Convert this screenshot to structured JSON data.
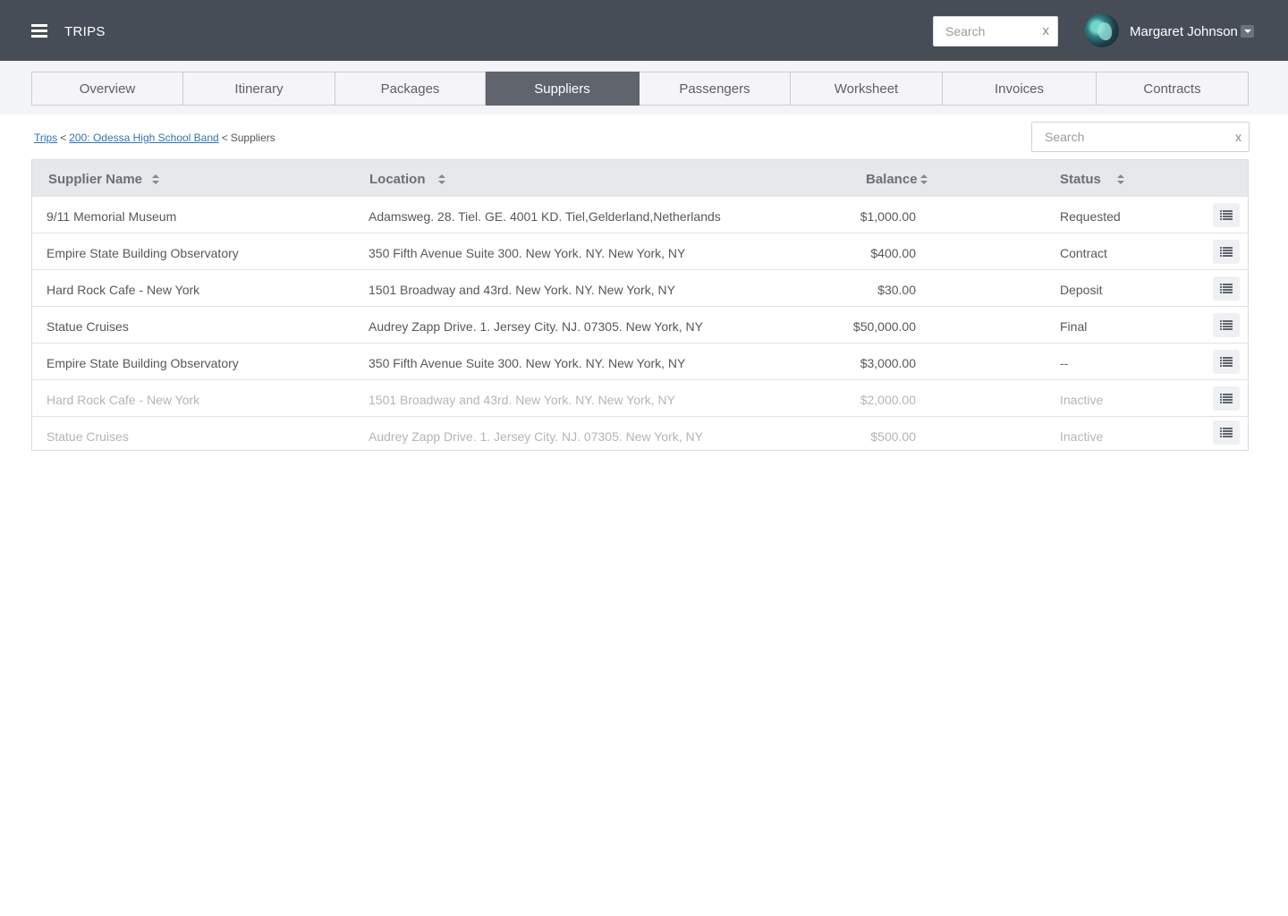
{
  "header": {
    "app_title": "TRIPS",
    "search_placeholder": "Search",
    "search_clear": "x",
    "user_name": "Margaret Johnson"
  },
  "tabs": [
    {
      "label": "Overview",
      "active": false
    },
    {
      "label": "Itinerary",
      "active": false
    },
    {
      "label": "Packages",
      "active": false
    },
    {
      "label": "Suppliers",
      "active": true
    },
    {
      "label": "Passengers",
      "active": false
    },
    {
      "label": "Worksheet",
      "active": false
    },
    {
      "label": "Invoices",
      "active": false
    },
    {
      "label": "Contracts",
      "active": false
    }
  ],
  "breadcrumb": {
    "root": "Trips",
    "trip": "200: Odessa High School Band",
    "current": "Suppliers",
    "separator": "<"
  },
  "list_search": {
    "placeholder": "Search",
    "clear": "x"
  },
  "table": {
    "columns": {
      "name": "Supplier Name",
      "location": "Location",
      "balance": "Balance",
      "status": "Status"
    },
    "rows": [
      {
        "name": "9/11 Memorial Museum",
        "location": "Adamsweg. 28. Tiel. GE. 4001 KD. Tiel,Gelderland,Netherlands",
        "balance": "$1,000.00",
        "status": "Requested",
        "inactive": false
      },
      {
        "name": "Empire State Building Observatory",
        "location": "350 Fifth Avenue Suite 300. New York. NY. New York, NY",
        "balance": "$400.00",
        "status": "Contract",
        "inactive": false
      },
      {
        "name": "Hard Rock Cafe - New York",
        "location": "1501 Broadway and 43rd. New York. NY. New York, NY",
        "balance": "$30.00",
        "status": "Deposit",
        "inactive": false
      },
      {
        "name": "Statue Cruises",
        "location": "Audrey Zapp Drive. 1. Jersey City. NJ. 07305. New York, NY",
        "balance": "$50,000.00",
        "status": "Final",
        "inactive": false
      },
      {
        "name": "Empire State Building Observatory",
        "location": "350 Fifth Avenue Suite 300. New York. NY. New York, NY",
        "balance": "$3,000.00",
        "status": "--",
        "inactive": false
      },
      {
        "name": "Hard Rock Cafe - New York",
        "location": "1501 Broadway and 43rd. New York. NY. New York, NY",
        "balance": "$2,000.00",
        "status": "Inactive",
        "inactive": true
      },
      {
        "name": "Statue Cruises",
        "location": "Audrey Zapp Drive. 1. Jersey City. NJ. 07305. New York, NY",
        "balance": "$500.00",
        "status": "Inactive",
        "inactive": true
      }
    ]
  },
  "icons": {
    "menu": "hamburger-icon",
    "row_action": "list-icon",
    "sort": "sort-icon",
    "user_dropdown": "caret-down-icon"
  },
  "colors": {
    "topbar": "#474d57",
    "active_tab": "#5f646d",
    "link": "#2f74b5"
  }
}
